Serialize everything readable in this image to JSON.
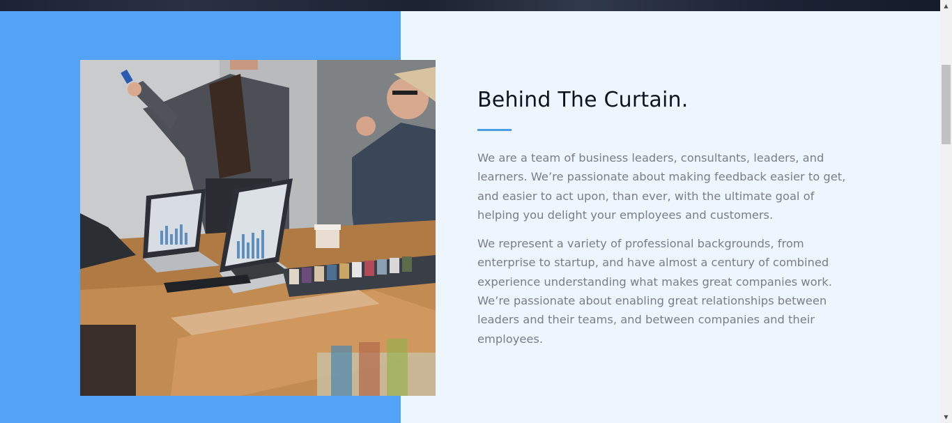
{
  "about": {
    "heading": "Behind The Curtain.",
    "paragraphs": [
      "We are a team of business leaders, consultants, leaders, and learners. We’re passionate about making feedback easier to get, and easier to act upon, than ever, with the ultimate goal of helping you delight your employees and customers.",
      "We represent a variety of professional backgrounds, from enterprise to startup, and have almost a century of combined experience understanding what makes great companies work. We’re passionate about enabling great relationships between leaders and their teams, and between companies and their employees."
    ]
  },
  "colors": {
    "panel_blue": "#52a3f6",
    "page_background": "#edf6fe",
    "heading": "#0e1320",
    "body_text": "#7a7d85",
    "divider": "#4c9de8"
  },
  "scrollbar": {
    "up_icon": "triangle-up-icon",
    "down_icon": "triangle-down-icon"
  }
}
